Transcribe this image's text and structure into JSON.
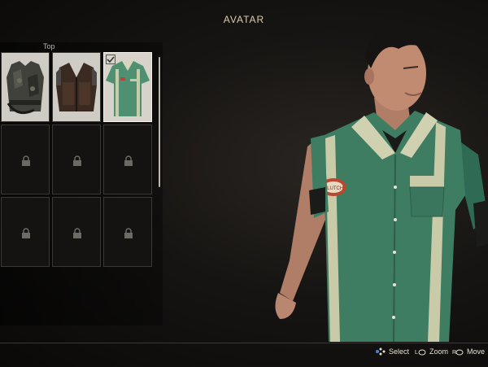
{
  "screen": {
    "title": "AVATAR"
  },
  "panel": {
    "category": "Top",
    "slots": [
      {
        "item": "camo-vest",
        "state": "unlocked"
      },
      {
        "item": "leather-vest",
        "state": "unlocked"
      },
      {
        "item": "green-bowling-shirt",
        "state": "selected"
      },
      {
        "state": "locked"
      },
      {
        "state": "locked"
      },
      {
        "state": "locked"
      },
      {
        "state": "locked"
      },
      {
        "state": "locked"
      },
      {
        "state": "locked"
      }
    ]
  },
  "character": {
    "shirt_badge": "CLUTCH"
  },
  "controls": {
    "select": {
      "label": "Select",
      "icon": "dpad-button-icon"
    },
    "zoom": {
      "label": "Zoom",
      "icon": "left-stick-icon"
    },
    "move": {
      "label": "Move",
      "icon": "right-stick-icon"
    }
  },
  "colors": {
    "title": "#d9ccae",
    "shirt": "#3f7d63",
    "shirt_trim": "#c9cba8"
  }
}
